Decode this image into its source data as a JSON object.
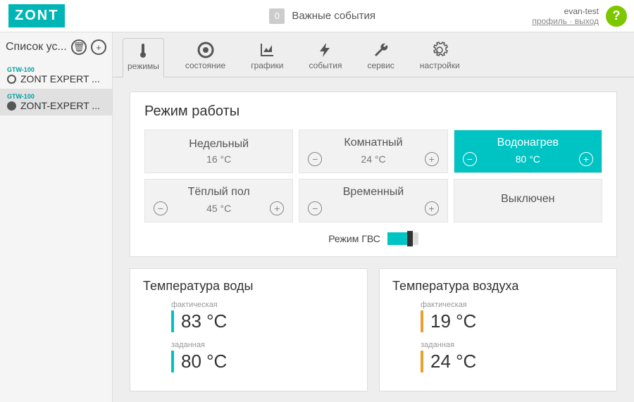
{
  "header": {
    "logo": "ZONT",
    "events_count": "0",
    "events_label": "Важные события",
    "user": "evan-test",
    "profile_link": "профиль",
    "logout_link": "выход"
  },
  "sidebar": {
    "title": "Список ус...",
    "devices": [
      {
        "type": "GTW-100",
        "name": "ZONT EXPERT ...",
        "selected": false
      },
      {
        "type": "GTW-100",
        "name": "ZONT-EXPERT ...",
        "selected": true
      }
    ]
  },
  "tabs": [
    {
      "id": "modes",
      "label": "режимы"
    },
    {
      "id": "status",
      "label": "состояние"
    },
    {
      "id": "charts",
      "label": "графики"
    },
    {
      "id": "events",
      "label": "события"
    },
    {
      "id": "service",
      "label": "сервис"
    },
    {
      "id": "settings",
      "label": "настройки"
    }
  ],
  "modes_card": {
    "title": "Режим работы",
    "tiles": [
      {
        "name": "Недельный",
        "temp": "16 °C",
        "has_controls": false
      },
      {
        "name": "Комнатный",
        "temp": "24 °C",
        "has_controls": true
      },
      {
        "name": "Водонагрев",
        "temp": "80 °C",
        "has_controls": true,
        "active": true
      },
      {
        "name": "Тёплый пол",
        "temp": "45 °C",
        "has_controls": true
      },
      {
        "name": "Временный",
        "temp": "",
        "has_controls": true
      },
      {
        "name": "Выключен",
        "temp": "",
        "has_controls": false
      }
    ],
    "gvs_label": "Режим ГВС"
  },
  "water_temp": {
    "title": "Температура воды",
    "actual_label": "фактическая",
    "actual_value": "83 °C",
    "target_label": "заданная",
    "target_value": "80 °C"
  },
  "air_temp": {
    "title": "Температура воздуха",
    "actual_label": "фактическая",
    "actual_value": "19 °C",
    "target_label": "заданная",
    "target_value": "24 °C"
  }
}
